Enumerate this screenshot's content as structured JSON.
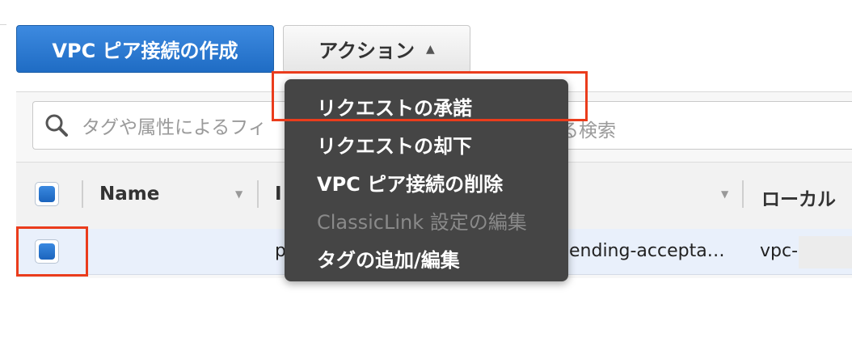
{
  "toolbar": {
    "create_label": "VPC ピア接続の作成",
    "actions_label": "アクション",
    "actions_chevron": "▲"
  },
  "search": {
    "placeholder_visible": "タグや属性によるフィ",
    "placeholder_tail": "る検索",
    "icon": "search-icon"
  },
  "table": {
    "columns": [
      "Name",
      "I",
      "ローカル"
    ],
    "rows": [
      {
        "name": "",
        "id_fragment": "p",
        "status": "ending-accepta…",
        "local_vpc": "vpc-"
      }
    ]
  },
  "action_menu": {
    "items": [
      {
        "label": "リクエストの承諾",
        "enabled": true
      },
      {
        "label": "リクエストの却下",
        "enabled": true
      },
      {
        "label": "VPC ピア接続の削除",
        "enabled": true
      },
      {
        "label": "ClassicLink 設定の編集",
        "enabled": false
      },
      {
        "label": "タグの追加/編集",
        "enabled": true
      }
    ]
  },
  "colors": {
    "primary_button": "#1f6cc4",
    "menu_background": "#454545",
    "highlight": "#ea3c1c",
    "selected_row": "#e9f0fb"
  }
}
